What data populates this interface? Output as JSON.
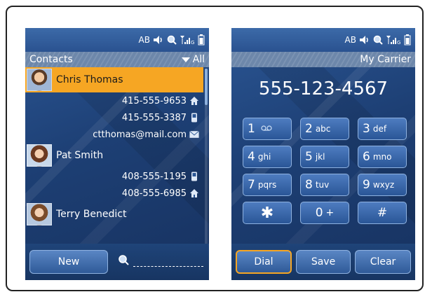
{
  "status": {
    "ab_label": "AB",
    "icons": [
      "speaker-icon",
      "search-icon",
      "signal-icon",
      "battery-icon"
    ]
  },
  "contacts": {
    "title": "Contacts",
    "filter": "All",
    "list": [
      {
        "name": "Chris Thomas",
        "selected": true,
        "details": [
          {
            "text": "415-555-9653",
            "icon": "home-icon"
          },
          {
            "text": "415-555-3387",
            "icon": "mobile-icon"
          },
          {
            "text": "ctthomas@mail.com",
            "icon": "mail-icon"
          }
        ]
      },
      {
        "name": "Pat Smith",
        "selected": false,
        "details": [
          {
            "text": "408-555-1195",
            "icon": "mobile-icon"
          },
          {
            "text": "408-555-6985",
            "icon": "home-icon"
          }
        ]
      },
      {
        "name": "Terry Benedict",
        "selected": false,
        "details": []
      }
    ],
    "new_button": "New"
  },
  "dialer": {
    "carrier": "My Carrier",
    "number": "555-123-4567",
    "keys": [
      {
        "main": "1",
        "sub": "voicemail-icon"
      },
      {
        "main": "2",
        "sub": "abc"
      },
      {
        "main": "3",
        "sub": "def"
      },
      {
        "main": "4",
        "sub": "ghi"
      },
      {
        "main": "5",
        "sub": "jkl"
      },
      {
        "main": "6",
        "sub": "mno"
      },
      {
        "main": "7",
        "sub": "pqrs"
      },
      {
        "main": "8",
        "sub": "tuv"
      },
      {
        "main": "9",
        "sub": "wxyz"
      },
      {
        "main": "✱",
        "sub": ""
      },
      {
        "main": "0",
        "sub": "+"
      },
      {
        "main": "#",
        "sub": ""
      }
    ],
    "buttons": {
      "dial": "Dial",
      "save": "Save",
      "clear": "Clear"
    }
  },
  "colors": {
    "selection": "#f6a623",
    "screen_bg": "#1d3f74",
    "button_border": "#8fb2e0"
  }
}
